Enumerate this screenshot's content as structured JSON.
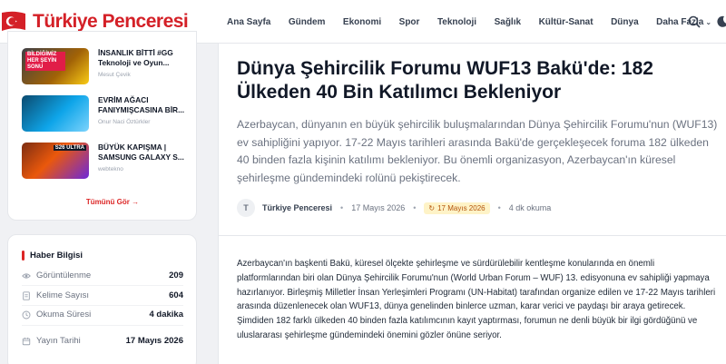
{
  "header": {
    "logo_text": "Türkiye Penceresi",
    "nav": [
      "Ana Sayfa",
      "Gündem",
      "Ekonomi",
      "Spor",
      "Teknoloji",
      "Sağlık",
      "Kültür-Sanat",
      "Dünya"
    ],
    "more_label": "Daha Fazla",
    "icons": [
      "search-icon",
      "moon-icon"
    ],
    "brand_color": "#d42027"
  },
  "sidebar": {
    "news": [
      {
        "title": "İNSANLIK BİTTİ #GG Teknoloji ve Oyun...",
        "author": "Mesut Çevik",
        "thumb_text": "BİLDİĞİMİZ HER ŞEYİN SONU"
      },
      {
        "title": "EVRİM AĞACI FANIYMIŞCASINA BİR...",
        "author": "Onur Naci Öztürkler",
        "thumb_text": ""
      },
      {
        "title": "BÜYÜK KAPIŞMA | SAMSUNG GALAXY S...",
        "author": "webtekno",
        "thumb_text": "S26 ULTRA"
      }
    ],
    "see_all": "Tümünü Gör →",
    "info": {
      "title": "Haber Bilgisi",
      "rows": [
        {
          "label": "Görüntülenme",
          "value": "209",
          "icon": "eye-icon"
        },
        {
          "label": "Kelime Sayısı",
          "value": "604",
          "icon": "document-icon"
        },
        {
          "label": "Okuma Süresi",
          "value": "4 dakika",
          "icon": "clock-icon"
        },
        {
          "label": "Yayın Tarihi",
          "value": "17 Mayıs 2026",
          "icon": "calendar-icon"
        }
      ]
    }
  },
  "article": {
    "title": "Dünya Şehircilik Forumu WUF13 Bakü'de: 182 Ülkeden 40 Bin Katılımcı Bekleniyor",
    "lead": "Azerbaycan, dünyanın en büyük şehircilik buluşmalarından Dünya Şehircilik Forumu'nun (WUF13) ev sahipliğini yapıyor. 17-22 Mayıs tarihleri arasında Bakü'de gerçekleşecek foruma 182 ülkeden 40 binden fazla kişinin katılımı bekleniyor. Bu önemli organizasyon, Azerbaycan'ın küresel şehirleşme gündemindeki rolünü pekiştirecek.",
    "avatar_letter": "T",
    "author": "Türkiye Penceresi",
    "date": "17 Mayıs 2026",
    "updated": "17 Mayıs 2026",
    "reading": "4 dk okuma",
    "body": "Azerbaycan'ın başkenti Bakü, küresel ölçekte şehirleşme ve sürdürülebilir kentleşme konularında en önemli platformlarından biri olan Dünya Şehircilik Forumu'nun (World Urban Forum – WUF) 13. edisyonuna ev sahipliği yapmaya hazırlanıyor. Birleşmiş Milletler İnsan Yerleşimleri Programı (UN-Habitat) tarafından organize edilen ve 17-22 Mayıs tarihleri arasında düzenlenecek olan WUF13, dünya genelinden binlerce uzman, karar verici ve paydaşı bir araya getirecek. Şimdiden 182 farklı ülkeden 40 binden fazla katılımcının kayıt yaptırması, forumun ne denli büyük bir ilgi gördüğünü ve uluslararası şehirleşme gündemindeki önemini gözler önüne seriyor."
  }
}
